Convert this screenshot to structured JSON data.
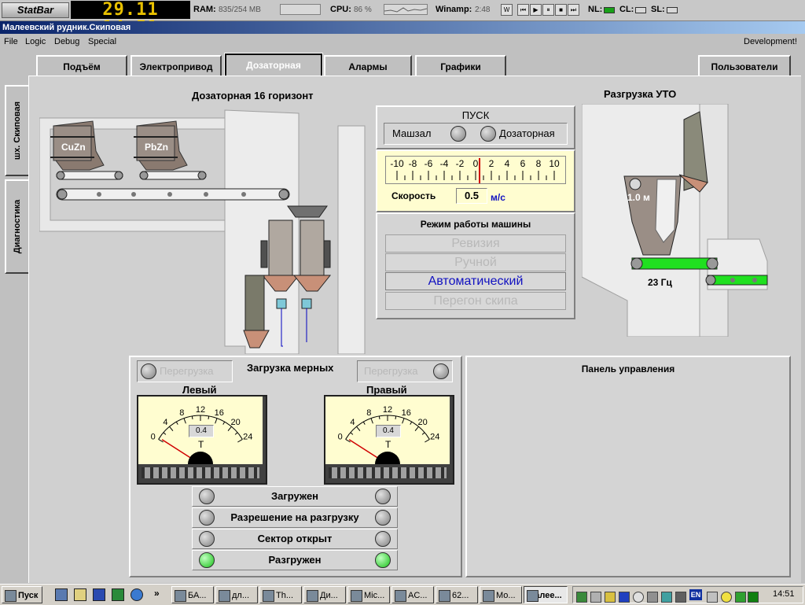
{
  "statbar": {
    "logo": "StatBar",
    "clock": "29.11 14:51",
    "ram_label": "RAM:",
    "ram_value": "835/254 MB",
    "cpu_label": "CPU:",
    "cpu_value": "86 %",
    "winamp_label": "Winamp:",
    "winamp_time": "2:48",
    "winamp_buttons": [
      "W",
      "⏮",
      "▶",
      "⏸",
      "■",
      "⏭"
    ],
    "nl_label": "NL:",
    "cl_label": "CL:",
    "sl_label": "SL:"
  },
  "window": {
    "title": "Малеевский рудник.Скиповая",
    "menu": [
      "File",
      "Logic",
      "Debug",
      "Special"
    ],
    "menu_right": "Development!"
  },
  "tabs": [
    {
      "label": "Подъём"
    },
    {
      "label": "Электропривод"
    },
    {
      "label": "Дозаторная"
    },
    {
      "label": "Алармы"
    },
    {
      "label": "Графики"
    }
  ],
  "users_tab": "Пользователи",
  "side_tabs": [
    "шх. Скиповая",
    "Диагностика"
  ],
  "dosing": {
    "title": "Дозаторная 16 горизонт",
    "bins": [
      "CuZn",
      "PbZn"
    ]
  },
  "start_panel": {
    "title": "ПУСК",
    "left": "Машзал",
    "right": "Дозаторная",
    "scale": [
      "-10",
      "-8",
      "-6",
      "-4",
      "-2",
      "0",
      "2",
      "4",
      "6",
      "8",
      "10"
    ],
    "speed_label": "Скорость",
    "speed_value": "0.5",
    "speed_unit": "м/с",
    "needle_value": 0.5
  },
  "mode_panel": {
    "title": "Режим работы машины",
    "modes": [
      "Ревизия",
      "Ручной",
      "Автоматический",
      "Перегон скипа"
    ],
    "active_index": 2
  },
  "unload": {
    "title": "Разгрузка УТО",
    "level": "1.0 м",
    "freq": "23 Гц"
  },
  "measure": {
    "title": "Загрузка мерных",
    "overload_left": "Перегрузка",
    "overload_right": "Перегрузка",
    "left_label": "Левый",
    "right_label": "Правый",
    "gauge_scale": [
      "0",
      "4",
      "8",
      "12",
      "16",
      "20",
      "24"
    ],
    "left_value": "0.4",
    "right_value": "0.4",
    "unit": "Т",
    "rows": [
      {
        "label": "Загружен",
        "on": false
      },
      {
        "label": "Разрешение на разгрузку",
        "on": false
      },
      {
        "label": "Сектор открыт",
        "on": false
      },
      {
        "label": "Разгружен",
        "on": true
      }
    ]
  },
  "control_panel": {
    "title": "Панель управления"
  },
  "taskbar": {
    "start": "Пуск",
    "tasks": [
      "БА...",
      "дл...",
      "Th...",
      "Ди...",
      "Mic...",
      "AC...",
      "62...",
      "Мо...",
      "Малее..."
    ],
    "active_task": 8,
    "lang": "EN",
    "clock": "14:51"
  },
  "colors": {
    "title_start": "#0a246a",
    "conveyor_green": "#20e020",
    "led_on": "#18c018",
    "mode_active": "#1010c0",
    "needle": "#d00000"
  }
}
